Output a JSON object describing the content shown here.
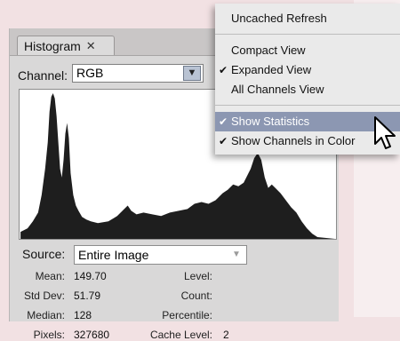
{
  "panel": {
    "tab_label": "Histogram",
    "tab_close": "✕",
    "channel_label": "Channel:",
    "channel_value": "RGB",
    "source_label": "Source:",
    "source_value": "Entire Image"
  },
  "stats": {
    "mean_label": "Mean:",
    "mean_value": "149.70",
    "stddev_label": "Std Dev:",
    "stddev_value": "51.79",
    "median_label": "Median:",
    "median_value": "128",
    "pixels_label": "Pixels:",
    "pixels_value": "327680",
    "level_label": "Level:",
    "count_label": "Count:",
    "percentile_label": "Percentile:",
    "cache_label": "Cache Level:",
    "cache_value": "2"
  },
  "menu": {
    "items": [
      {
        "label": "Uncached Refresh",
        "checked": false
      },
      {
        "label": "Compact View",
        "checked": false
      },
      {
        "label": "Expanded View",
        "checked": true
      },
      {
        "label": "All Channels View",
        "checked": false
      },
      {
        "label": "Show Statistics",
        "checked": true,
        "highlighted": true
      },
      {
        "label": "Show Channels in Color",
        "checked": true
      }
    ],
    "check_glyph": "✔"
  },
  "colors": {
    "menu_highlight": "#8c97b2",
    "histogram_fill": "#1e1e1e"
  },
  "icons": {
    "dropdown": "chevron-down-icon",
    "cursor": "arrow-cursor-icon"
  }
}
